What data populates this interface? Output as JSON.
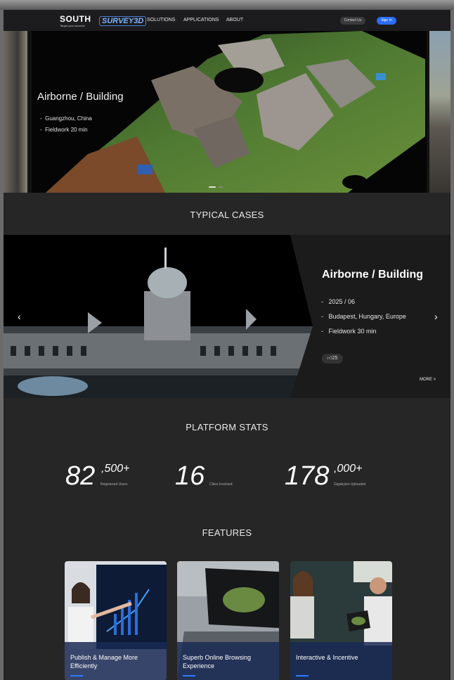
{
  "nav": {
    "brand": "SOUTH",
    "brand_tagline": "Target your success",
    "product": "SURVEY3D",
    "links": [
      "SOLUTIONS",
      "APPLICATIONS",
      "ABOUT"
    ],
    "contact": "Contact Us",
    "signin": "Sign In"
  },
  "hero": {
    "title": "Airborne / Building",
    "meta": [
      "Guangzhou, China",
      "Fieldwork 20 min"
    ]
  },
  "typical_cases": {
    "heading": "TYPICAL CASES",
    "title": "Airborne / Building",
    "meta": [
      "2025 / 06",
      "Budapest, Hungary, Europe",
      "Fieldwork 30 min"
    ],
    "likes": "25",
    "more": "MORE >"
  },
  "stats": {
    "heading": "PLATFORM STATS",
    "items": [
      {
        "num": "82",
        "sup": ",500+",
        "label": "Registered Users"
      },
      {
        "num": "16",
        "sup": "",
        "label": "Cities Involved"
      },
      {
        "num": "178",
        "sup": ",000+",
        "label": "Gigabytes Uploaded"
      }
    ]
  },
  "features": {
    "heading": "FEATURES",
    "cards": [
      {
        "line1": "Publish & Manage More",
        "line2": "Efficiently"
      },
      {
        "line1": "Superb Online Browsing",
        "line2": "Experience"
      },
      {
        "line1": "Interactive & Incentive",
        "line2": ""
      }
    ]
  },
  "icons": {
    "prev": "chevron-left-icon",
    "next": "chevron-right-icon",
    "like": "thumbs-up-icon"
  },
  "colors": {
    "accent": "#2b6df6",
    "background": "#262626",
    "nav": "#1c1c1e"
  }
}
